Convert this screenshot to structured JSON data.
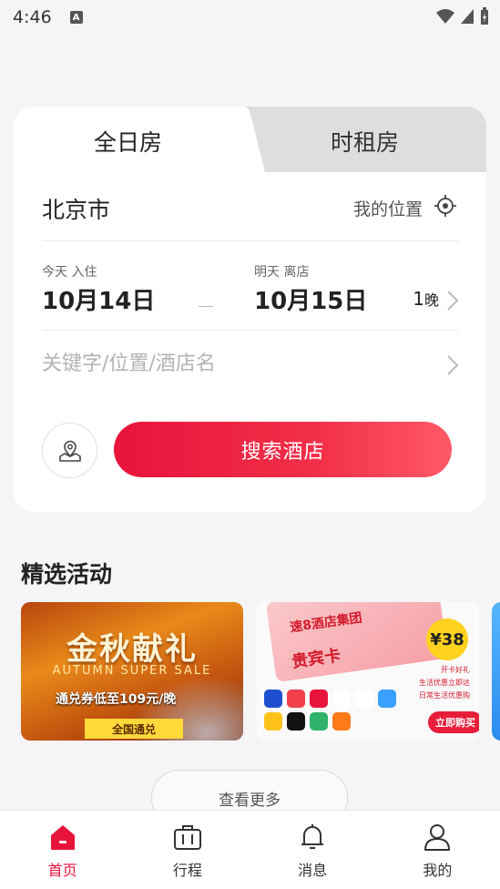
{
  "status_bar": {
    "time": "4:46",
    "notification_badge": "A"
  },
  "booking": {
    "tabs": [
      {
        "label": "全日房",
        "active": true
      },
      {
        "label": "时租房",
        "active": false
      }
    ],
    "city": "北京市",
    "my_location_label": "我的位置",
    "checkin": {
      "label": "今天 入住",
      "date": "10月14日"
    },
    "checkout": {
      "label": "明天 离店",
      "date": "10月15日"
    },
    "nights": {
      "count": "1",
      "unit": "晚"
    },
    "keyword_placeholder": "关键字/位置/酒店名",
    "search_button": "搜索酒店"
  },
  "activities": {
    "title": "精选活动",
    "banners": [
      {
        "title": "金秋献礼",
        "subtitle": "AUTUMN SUPER SALE",
        "line": "通兑券低至109元/晚",
        "tag": "全国通兑"
      },
      {
        "brand": "速8酒店集团",
        "card_title": "贵宾卡",
        "price": "¥38",
        "benefits": [
          "开卡好礼",
          "生活优惠立即达",
          "日常生活优惠购"
        ],
        "buy_label": "立即购买"
      }
    ],
    "more_label": "查看更多"
  },
  "tabbar": {
    "items": [
      {
        "label": "首页",
        "icon": "home-icon",
        "active": true
      },
      {
        "label": "行程",
        "icon": "luggage-icon",
        "active": false
      },
      {
        "label": "消息",
        "icon": "bell-icon",
        "active": false
      },
      {
        "label": "我的",
        "icon": "user-icon",
        "active": false
      }
    ]
  },
  "colors": {
    "accent": "#e8133b",
    "tab_inactive_bg": "#dedede"
  }
}
